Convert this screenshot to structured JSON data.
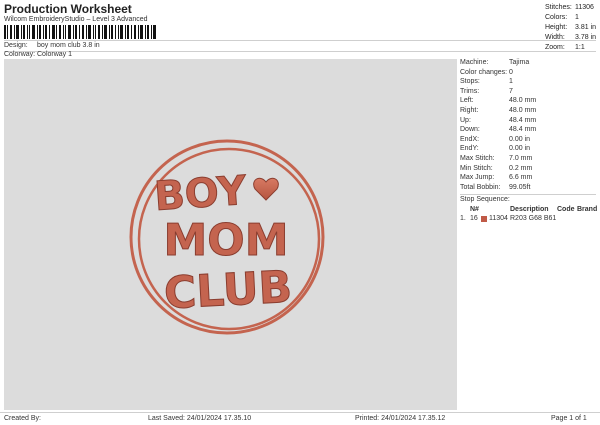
{
  "header": {
    "title": "Production Worksheet",
    "subtitle": "Wilcom EmbroideryStudio – Level 3 Advanced",
    "design_label": "Design:",
    "design_value": "boy mom club 3.8 in",
    "colorway_label": "Colorway:",
    "colorway_value": "Colorway 1"
  },
  "stats": [
    {
      "k": "Stitches:",
      "v": "11306"
    },
    {
      "k": "Colors:",
      "v": "1"
    },
    {
      "k": "Height:",
      "v": "3.81 in"
    },
    {
      "k": "Width:",
      "v": "3.78 in"
    },
    {
      "k": "Zoom:",
      "v": "1:1"
    }
  ],
  "details": [
    {
      "k": "Machine:",
      "v": "Tajima"
    },
    {
      "k": "Color changes:",
      "v": "0"
    },
    {
      "k": "Stops:",
      "v": "1"
    },
    {
      "k": "Trims:",
      "v": "7"
    },
    {
      "k": "Left:",
      "v": "48.0 mm"
    },
    {
      "k": "Right:",
      "v": "48.0 mm"
    },
    {
      "k": "Up:",
      "v": "48.4 mm"
    },
    {
      "k": "Down:",
      "v": "48.4 mm"
    },
    {
      "k": "EndX:",
      "v": "0.00 in"
    },
    {
      "k": "EndY:",
      "v": "0.00 in"
    },
    {
      "k": "Max Stitch:",
      "v": "7.0 mm"
    },
    {
      "k": "Min Stitch:",
      "v": "0.2 mm"
    },
    {
      "k": "Max Jump:",
      "v": "6.6 mm"
    },
    {
      "k": "Total Bobbin:",
      "v": "99.05ft"
    }
  ],
  "sequence": {
    "title": "Stop Sequence:",
    "headers": {
      "n": "N#",
      "desc": "Description",
      "code": "Code",
      "brand": "Brand"
    },
    "rows": [
      {
        "idx": "1.",
        "n": "16",
        "stitches": "11304",
        "desc": "R203 G68 B61",
        "code": "",
        "brand": ""
      }
    ]
  },
  "design_text": {
    "line1": "BOY",
    "line2": "MOM",
    "line3": "CLUB"
  },
  "colors": {
    "thread": "#c4644f",
    "background": "#dcdcdc"
  },
  "footer": {
    "created_by": "Created By:",
    "last_saved": "Last Saved: 24/01/2024 17.35.10",
    "printed": "Printed: 24/01/2024 17.35.12",
    "page": "Page 1 of 1"
  }
}
